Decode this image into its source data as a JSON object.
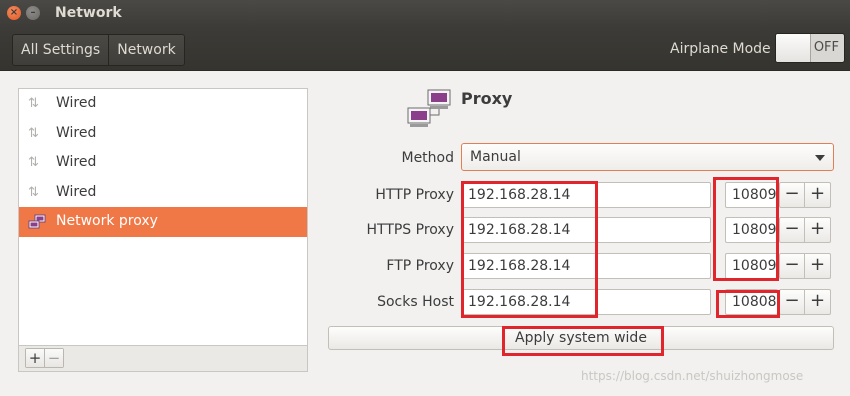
{
  "window": {
    "title": "Network"
  },
  "header": {
    "breadcrumbs": [
      "All Settings",
      "Network"
    ],
    "airplane_label": "Airplane Mode",
    "airplane_state": "OFF"
  },
  "devices": [
    {
      "label": "Wired",
      "icon": "network-wired-icon",
      "selected": false
    },
    {
      "label": "Wired",
      "icon": "network-wired-icon",
      "selected": false
    },
    {
      "label": "Wired",
      "icon": "network-wired-icon",
      "selected": false
    },
    {
      "label": "Wired",
      "icon": "network-wired-icon",
      "selected": false
    },
    {
      "label": "Network proxy",
      "icon": "network-proxy-icon",
      "selected": true
    }
  ],
  "list_buttons": {
    "add": "+",
    "remove": "−"
  },
  "proxy": {
    "title": "Proxy",
    "method_label": "Method",
    "method_value": "Manual",
    "rows": [
      {
        "label": "HTTP Proxy",
        "host": "192.168.28.14",
        "port": "10809"
      },
      {
        "label": "HTTPS Proxy",
        "host": "192.168.28.14",
        "port": "10809"
      },
      {
        "label": "FTP Proxy",
        "host": "192.168.28.14",
        "port": "10809"
      },
      {
        "label": "Socks Host",
        "host": "192.168.28.14",
        "port": "10808"
      }
    ],
    "stepper_minus": "−",
    "stepper_plus": "+",
    "apply_label": "Apply system wide"
  },
  "watermark": "https://blog.csdn.net/shuizhongmose",
  "colors": {
    "accent": "#f07746",
    "annotation": "#e0252d",
    "headerbar": "#3c3b37"
  }
}
